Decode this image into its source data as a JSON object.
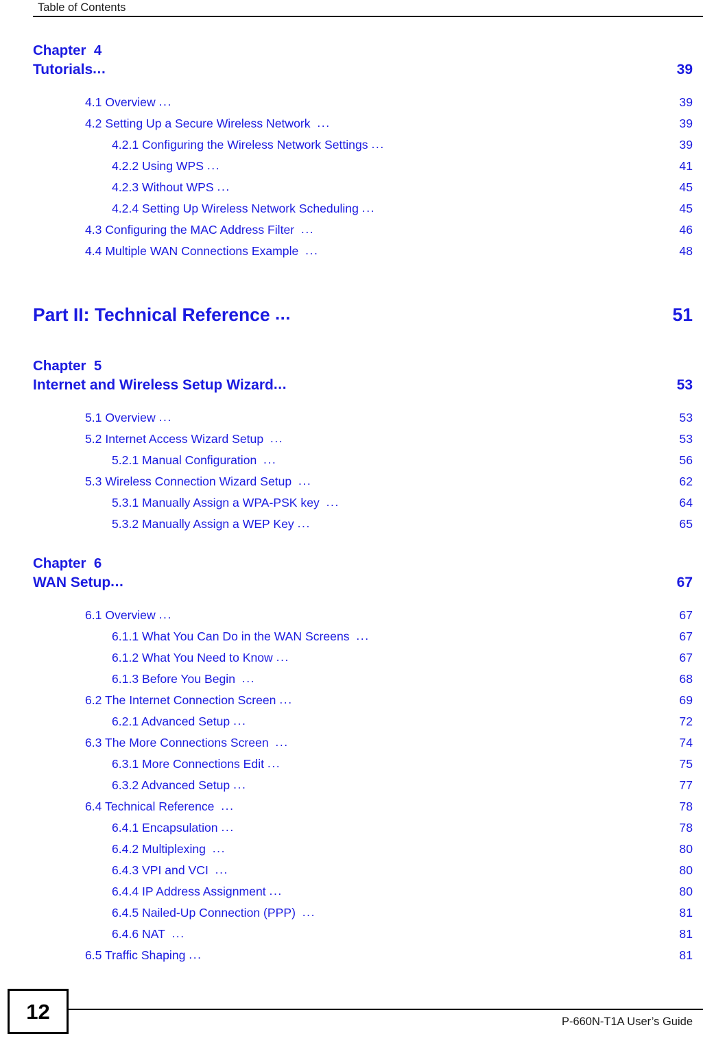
{
  "header": {
    "title": "Table of Contents"
  },
  "footer": {
    "page_number": "12",
    "guide_title": "P-660N-T1A User’s Guide"
  },
  "colors": {
    "link_blue": "#1b1be0",
    "text_black": "#000000"
  },
  "toc": {
    "chapter4": {
      "label": "Chapter  4",
      "title": "Tutorials",
      "page": "39",
      "entries": [
        {
          "label": "4.1 Overview ",
          "page": "39",
          "level": 1
        },
        {
          "label": "4.2 Setting Up a Secure Wireless Network  ",
          "page": "39",
          "level": 1
        },
        {
          "label": "4.2.1 Configuring the Wireless Network Settings ",
          "page": "39",
          "level": 2
        },
        {
          "label": "4.2.2 Using WPS ",
          "page": "41",
          "level": 2
        },
        {
          "label": "4.2.3 Without WPS ",
          "page": "45",
          "level": 2
        },
        {
          "label": "4.2.4 Setting Up Wireless Network Scheduling ",
          "page": "45",
          "level": 2
        },
        {
          "label": "4.3 Configuring the MAC Address Filter  ",
          "page": "46",
          "level": 1
        },
        {
          "label": "4.4 Multiple WAN Connections Example  ",
          "page": "48",
          "level": 1
        }
      ]
    },
    "part2": {
      "title": "Part II: Technical Reference ",
      "page": " 51"
    },
    "chapter5": {
      "label": "Chapter  5",
      "title": "Internet and Wireless Setup Wizard",
      "page": "53",
      "entries": [
        {
          "label": "5.1 Overview ",
          "page": "53",
          "level": 1
        },
        {
          "label": "5.2 Internet Access Wizard Setup  ",
          "page": "53",
          "level": 1
        },
        {
          "label": "5.2.1 Manual Configuration  ",
          "page": "56",
          "level": 2
        },
        {
          "label": "5.3 Wireless Connection Wizard Setup  ",
          "page": "62",
          "level": 1
        },
        {
          "label": "5.3.1 Manually Assign a WPA-PSK key  ",
          "page": "64",
          "level": 2
        },
        {
          "label": "5.3.2 Manually Assign a WEP Key ",
          "page": "65",
          "level": 2
        }
      ]
    },
    "chapter6": {
      "label": "Chapter  6",
      "title": "WAN Setup",
      "page": "67",
      "entries": [
        {
          "label": "6.1 Overview ",
          "page": "67",
          "level": 1
        },
        {
          "label": "6.1.1 What You Can Do in the WAN Screens  ",
          "page": "67",
          "level": 2
        },
        {
          "label": "6.1.2 What You Need to Know ",
          "page": "67",
          "level": 2
        },
        {
          "label": "6.1.3 Before You Begin  ",
          "page": "68",
          "level": 2
        },
        {
          "label": "6.2 The Internet Connection Screen ",
          "page": "69",
          "level": 1
        },
        {
          "label": "6.2.1 Advanced Setup ",
          "page": "72",
          "level": 2
        },
        {
          "label": "6.3 The More Connections Screen  ",
          "page": "74",
          "level": 1
        },
        {
          "label": "6.3.1 More Connections Edit ",
          "page": "75",
          "level": 2
        },
        {
          "label": "6.3.2 Advanced Setup ",
          "page": "77",
          "level": 2
        },
        {
          "label": "6.4 Technical Reference  ",
          "page": "78",
          "level": 1
        },
        {
          "label": "6.4.1 Encapsulation ",
          "page": "78",
          "level": 2
        },
        {
          "label": "6.4.2 Multiplexing  ",
          "page": "80",
          "level": 2
        },
        {
          "label": "6.4.3 VPI and VCI  ",
          "page": "80",
          "level": 2
        },
        {
          "label": "6.4.4 IP Address Assignment ",
          "page": "80",
          "level": 2
        },
        {
          "label": "6.4.5 Nailed-Up Connection (PPP)  ",
          "page": "81",
          "level": 2
        },
        {
          "label": "6.4.6 NAT  ",
          "page": "81",
          "level": 2
        },
        {
          "label": "6.5 Traffic Shaping ",
          "page": "81",
          "level": 1
        }
      ]
    }
  }
}
